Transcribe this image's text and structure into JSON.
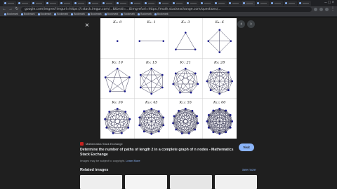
{
  "browser": {
    "tab_count": 22,
    "active_tab_index": 17,
    "window_controls": "– □ ×",
    "url": "google.com/imgres?imgurl=https://i.stack.imgur.com/...&tbnid=...&imgrefurl=https://math.stackexchange.com/questions/...",
    "bookmarks": [
      "Bookmark",
      "Bookmark",
      "Bookmark",
      "Bookmark",
      "Bookmark",
      "Bookmark",
      "Bookmark",
      "Bookmark",
      "Bookmark",
      "Bookmark"
    ]
  },
  "viewer": {
    "close_icon": "×",
    "top_icons": [
      "⋮",
      "⤢",
      "↗"
    ],
    "prev_arrow": "‹",
    "next_arrow": "›"
  },
  "image": {
    "graphs": [
      {
        "label": "K₁: 0",
        "n": 1
      },
      {
        "label": "K₂: 1",
        "n": 2
      },
      {
        "label": "K₃: 3",
        "n": 3
      },
      {
        "label": "K₄: 6",
        "n": 4
      },
      {
        "label": "K₅: 10",
        "n": 5
      },
      {
        "label": "K₆: 15",
        "n": 6
      },
      {
        "label": "K₇: 21",
        "n": 7
      },
      {
        "label": "K₈: 28",
        "n": 8
      },
      {
        "label": "K₉: 36",
        "n": 9
      },
      {
        "label": "K₁₀: 45",
        "n": 10
      },
      {
        "label": "K₁₁: 55",
        "n": 11
      },
      {
        "label": "K₁₂: 66",
        "n": 12
      }
    ],
    "edge_color": "#2a2a4a",
    "node_color": "#1a1a8c"
  },
  "info": {
    "source_name": "Mathematics Stack Exchange",
    "title": "Determine the number of paths of length 2 in a complete graph of n nodes - Mathematics Stack Exchange",
    "disclaimer": "Images may be subject to copyright.",
    "learn_more": "Learn More",
    "visit_label": "Visit"
  },
  "related": {
    "heading": "Related images",
    "see_more": "See more"
  },
  "colors": {
    "accent": "#8ab4f8",
    "background": "#1f1f1f"
  }
}
